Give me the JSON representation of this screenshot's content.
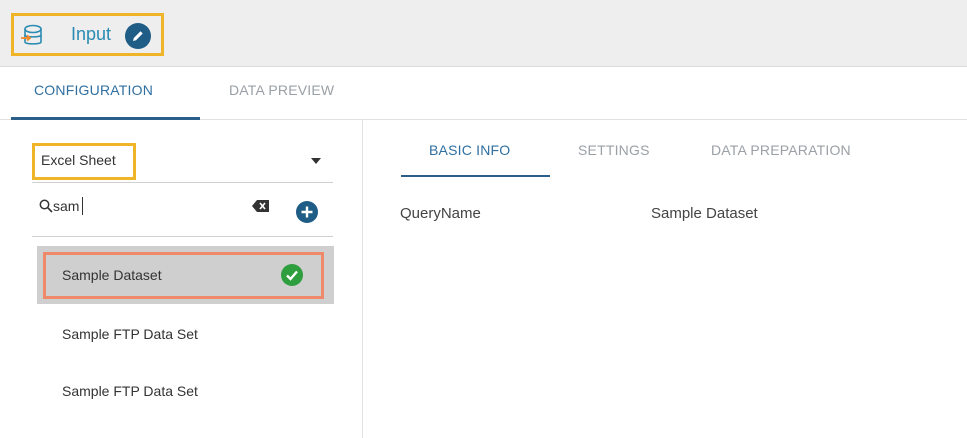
{
  "header": {
    "title": "Input",
    "icon": "database-import-icon",
    "edit_icon": "pencil-edit-icon",
    "accent_color": "#2b8bb3"
  },
  "top_tabs": [
    {
      "label": "CONFIGURATION",
      "active": true
    },
    {
      "label": "DATA PREVIEW",
      "active": false
    }
  ],
  "left": {
    "source_select": {
      "value": "Excel Sheet"
    },
    "search": {
      "value": "sam"
    },
    "items": [
      {
        "label": "Sample Dataset",
        "selected": true
      },
      {
        "label": "Sample FTP Data Set",
        "selected": false
      },
      {
        "label": "Sample FTP Data Set",
        "selected": false
      }
    ]
  },
  "right": {
    "tabs": [
      {
        "label": "BASIC INFO",
        "active": true
      },
      {
        "label": "SETTINGS",
        "active": false
      },
      {
        "label": "DATA PREPARATION",
        "active": false
      }
    ],
    "fields": [
      {
        "label": "QueryName",
        "value": "Sample Dataset"
      }
    ]
  },
  "colors": {
    "highlight_box": "#f0b429",
    "selected_outline": "#ee8a6a",
    "success": "#2e9e3e",
    "primary_dark": "#1f5c86"
  }
}
